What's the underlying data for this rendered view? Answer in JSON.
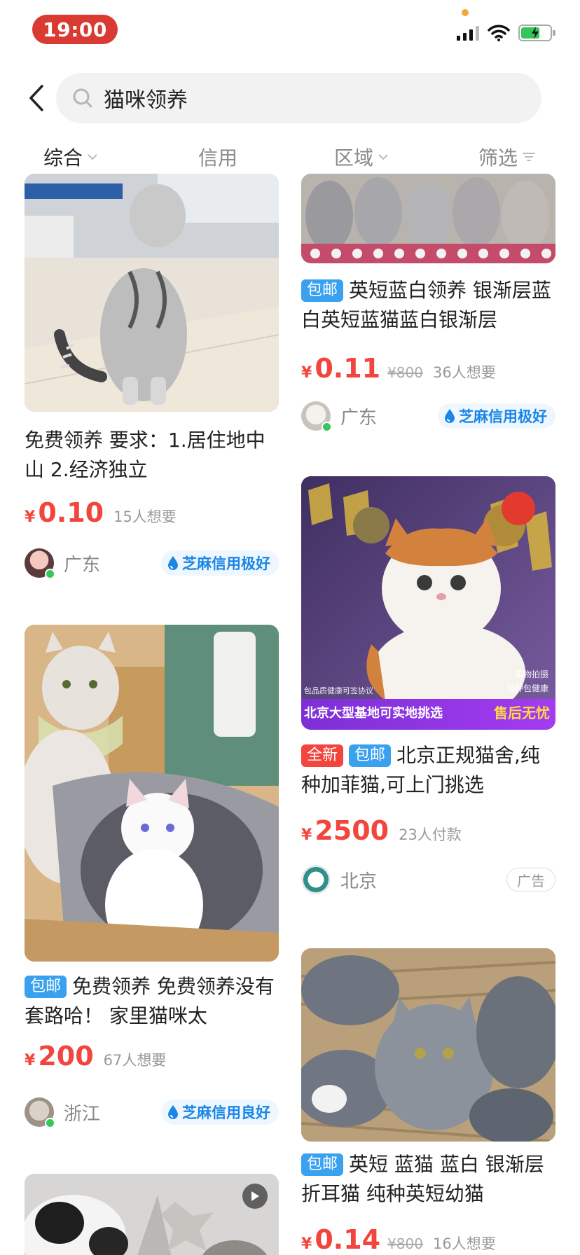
{
  "status_bar": {
    "time": "19:00"
  },
  "search": {
    "query": "猫咪领养"
  },
  "filters": [
    {
      "label": "综合"
    },
    {
      "label": "信用"
    },
    {
      "label": "区域"
    },
    {
      "label": "筛选"
    }
  ],
  "left_column": [
    {
      "title": "免费领养 要求：1.居住地中山            2.经济独立",
      "price": "0.10",
      "want": "15人想要",
      "region": "广东",
      "credit": "芝麻信用极好"
    },
    {
      "tag": "包邮",
      "title": "免费领养 免费领养没有套路哈！ 家里猫咪太",
      "price": "200",
      "want": "67人想要",
      "region": "浙江",
      "credit": "芝麻信用良好"
    }
  ],
  "right_column": [
    {
      "tag": "包邮",
      "title": "英短蓝白领养 银渐层蓝白英短蓝猫蓝白银渐层",
      "price": "0.11",
      "original_price": "¥800",
      "want": "36人想要",
      "region": "广东",
      "credit": "芝麻信用极好"
    },
    {
      "tags": [
        "全新",
        "包邮"
      ],
      "title": "北京正规猫舍,纯种加菲猫,可上门挑选",
      "image_text": {
        "badge": "实物拍摄",
        "sub": "纯种包健康",
        "protocol": "包品质健康可签协议",
        "banner_left": "北京大型基地可实地挑选",
        "banner_right": "售后无忧"
      },
      "price": "2500",
      "want": "23人付款",
      "region": "北京",
      "ad_label": "广告"
    },
    {
      "tag": "包邮",
      "title": "英短 蓝猫 蓝白 银渐层 折耳猫 纯种英短幼猫",
      "price": "0.14",
      "original_price": "¥800",
      "want": "16人想要"
    }
  ],
  "currency_symbol": "¥",
  "colors": {
    "accent_red": "#f2453d",
    "tag_blue": "#3aa1ef",
    "credit_blue": "#1b86e5",
    "time_pill": "#d93a32"
  }
}
